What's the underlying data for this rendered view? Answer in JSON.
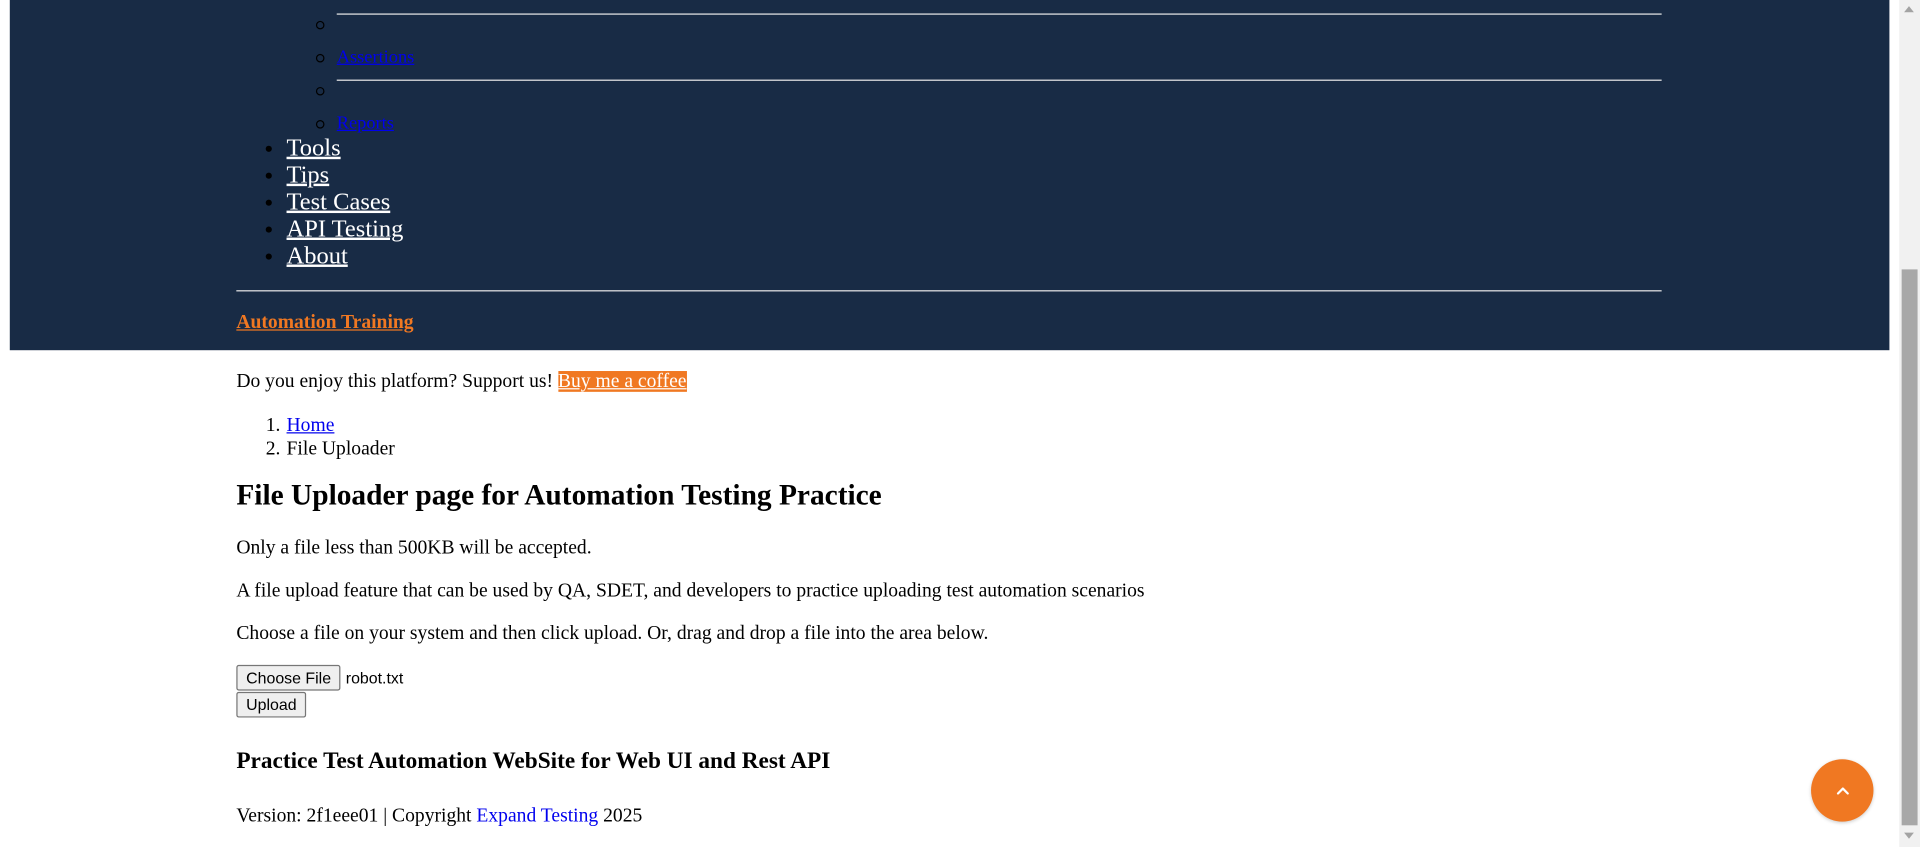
{
  "nav": {
    "sub_items": [
      {
        "label": "Assertions"
      },
      {
        "label": "Reports"
      }
    ],
    "items": [
      {
        "label": "Tools"
      },
      {
        "label": "Tips"
      },
      {
        "label": "Test Cases"
      },
      {
        "label": "API Testing"
      },
      {
        "label": "About"
      }
    ],
    "training_label": "Automation Training"
  },
  "support": {
    "text": "Do you enjoy this platform? Support us!",
    "coffee_label": "Buy me a coffee"
  },
  "breadcrumb": {
    "items": [
      {
        "num": "1.",
        "label": "Home"
      },
      {
        "num": "2.",
        "label": "File Uploader"
      }
    ]
  },
  "main": {
    "title": "File Uploader page for Automation Testing Practice",
    "para1": "Only a file less than 500KB will be accepted.",
    "para2": "A file upload feature that can be used by QA, SDET, and developers to practice uploading test automation scenarios",
    "para3": "Choose a file on your system and then click upload. Or, drag and drop a file into the area below.",
    "choose_file_label": "Choose File",
    "file_name": "robot.txt",
    "upload_label": "Upload"
  },
  "footer": {
    "title": "Practice Test Automation WebSite for Web UI and Rest API",
    "version_prefix": "Version: 2f1eee01 | Copyright",
    "company_link": "Expand Testing",
    "year": "2025"
  },
  "colors": {
    "header_bg": "#182b45",
    "accent": "#f07822",
    "link": "#0000ee"
  },
  "icons": {
    "back_to_top": "chevron-up-icon"
  }
}
